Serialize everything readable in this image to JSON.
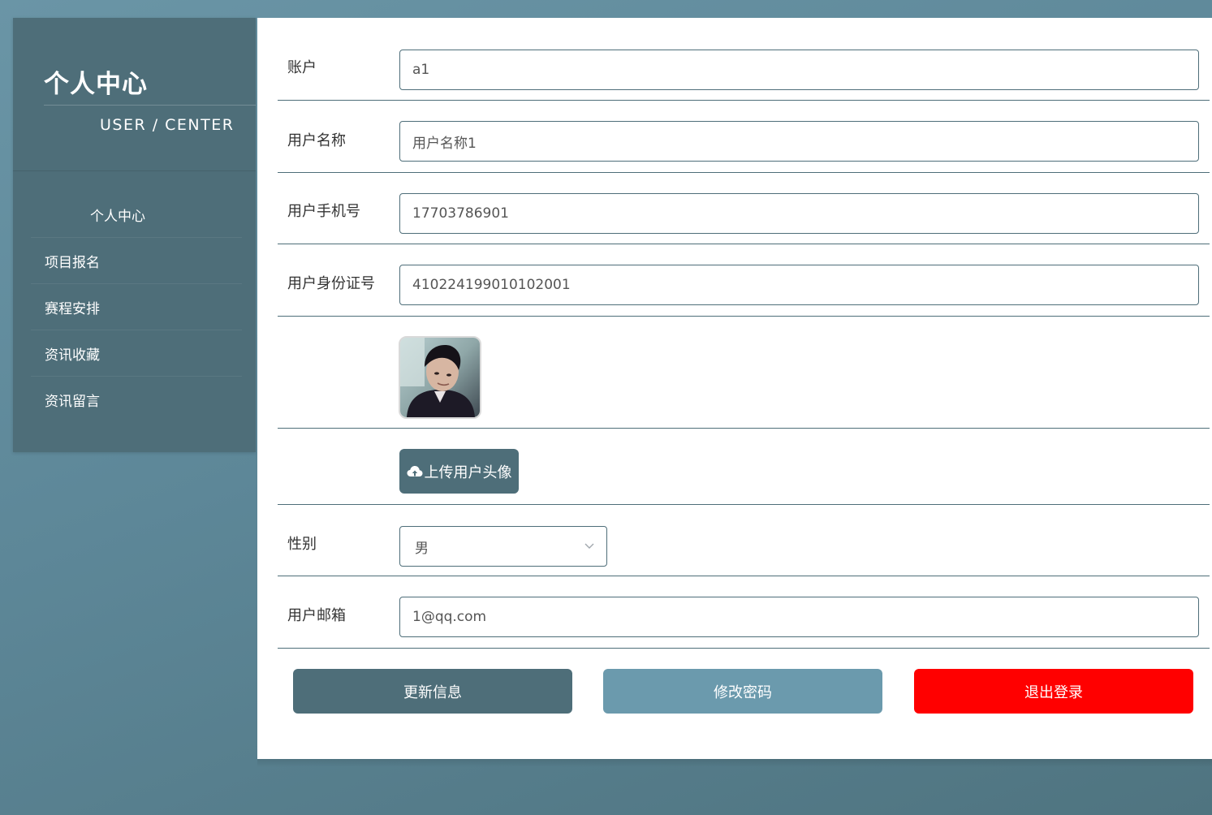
{
  "sidebar": {
    "title": "个人中心",
    "subtitle": "USER / CENTER",
    "items": [
      {
        "label": "个人中心"
      },
      {
        "label": "项目报名"
      },
      {
        "label": "赛程安排"
      },
      {
        "label": "资讯收藏"
      },
      {
        "label": "资讯留言"
      }
    ]
  },
  "form": {
    "account": {
      "label": "账户",
      "value": "a1"
    },
    "username": {
      "label": "用户名称",
      "value": "用户名称1"
    },
    "phone": {
      "label": "用户手机号",
      "value": "17703786901"
    },
    "idcard": {
      "label": "用户身份证号",
      "value": "410224199010102001"
    },
    "upload_label": "上传用户头像",
    "gender": {
      "label": "性别",
      "value": "男"
    },
    "email": {
      "label": "用户邮箱",
      "value": "1@qq.com"
    }
  },
  "buttons": {
    "update": "更新信息",
    "change_password": "修改密码",
    "logout": "退出登录"
  },
  "colors": {
    "primary": "#4e6e79",
    "secondary": "#6b9aad",
    "danger": "#ff0000",
    "background": "#5d8798"
  },
  "icons": {
    "upload": "cloud-upload-icon",
    "select": "chevron-down-icon"
  }
}
